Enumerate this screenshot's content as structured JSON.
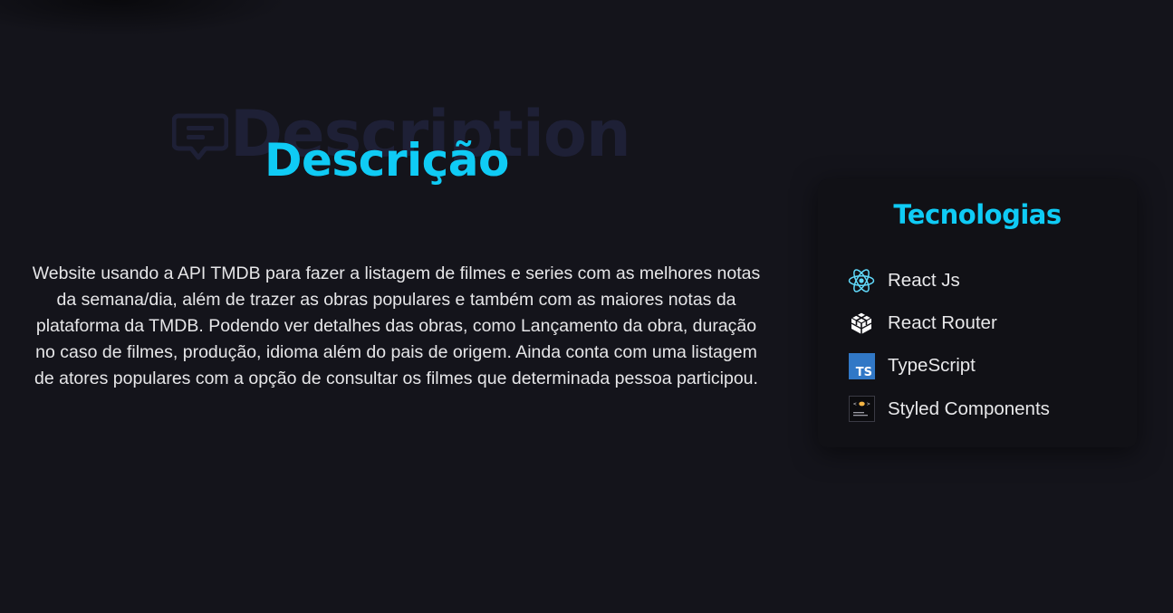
{
  "description_section": {
    "background_word": "Description",
    "title": "Descrição",
    "text": "Website usando a API TMDB para fazer a listagem de filmes e series com as melhores notas da semana/dia, além de trazer as obras populares e também com as maiores notas da plataforma da TMDB. Podendo ver detalhes das obras, como Lançamento da obra, duração no caso de filmes, produção, idioma além do pais de origem. Ainda conta com uma listagem de atores populares com a opção de consultar os filmes que determinada pessoa participou."
  },
  "technologies": {
    "title": "Tecnologias",
    "items": [
      {
        "label": "React Js",
        "icon": "react-icon"
      },
      {
        "label": "React Router",
        "icon": "react-router-icon"
      },
      {
        "label": "TypeScript",
        "icon": "typescript-icon",
        "icon_text": "TS"
      },
      {
        "label": "Styled Components",
        "icon": "styled-components-icon"
      }
    ]
  },
  "colors": {
    "background": "#14141b",
    "accent": "#0fcbf5",
    "background_heading": "#1e2036",
    "card": "#111116",
    "text": "#e6e6e8"
  }
}
